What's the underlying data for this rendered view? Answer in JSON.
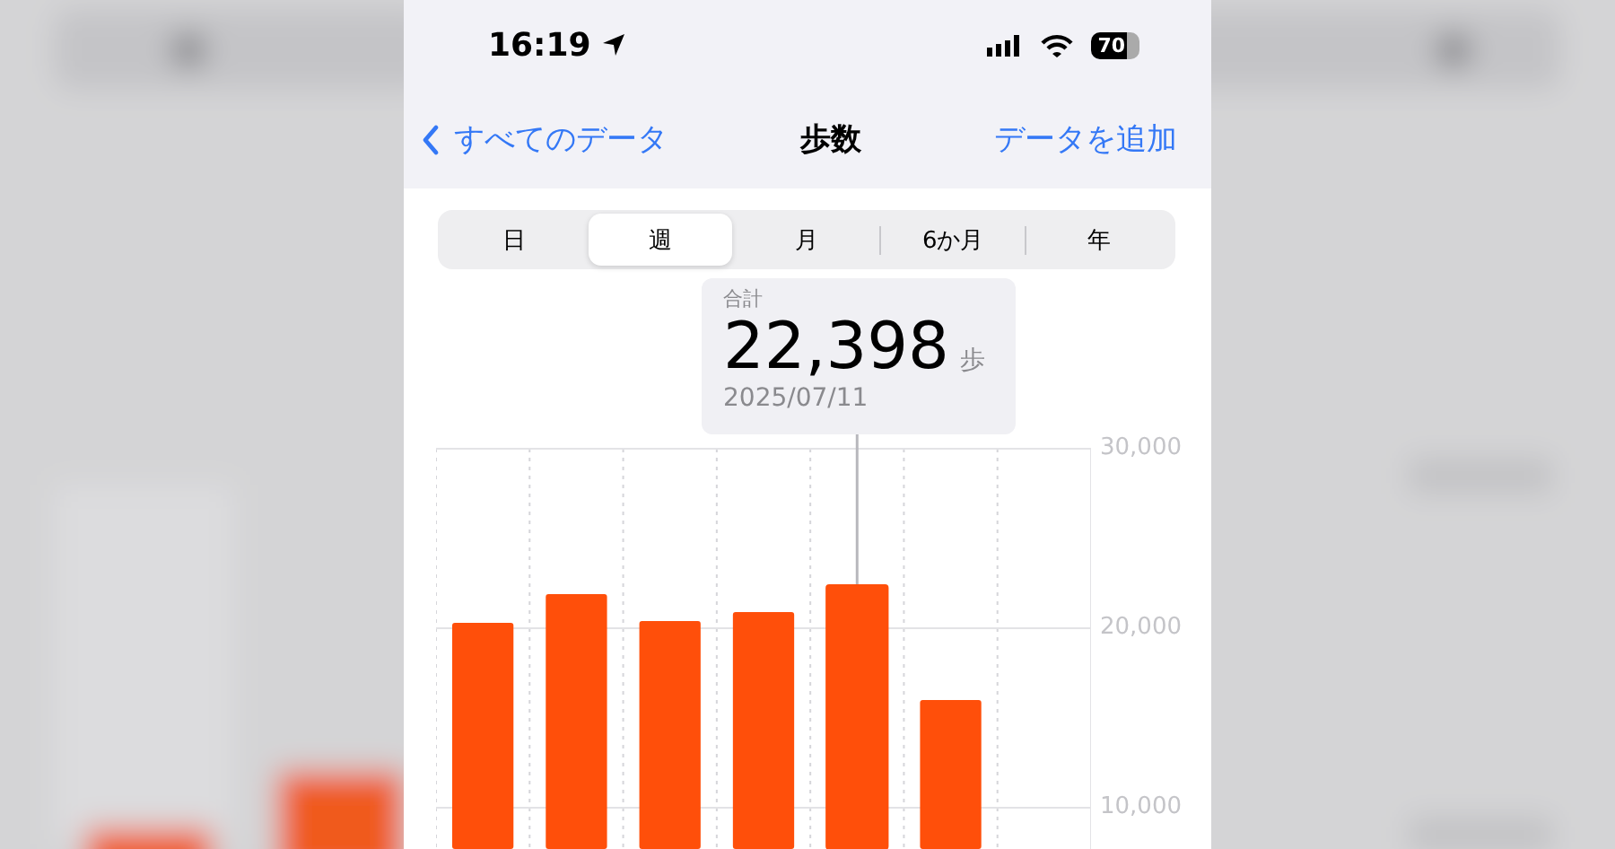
{
  "status_bar": {
    "time": "16:19",
    "battery": "70"
  },
  "nav": {
    "back": "すべてのデータ",
    "title": "歩数",
    "action": "データを追加"
  },
  "tabs": [
    {
      "label": "日",
      "selected": false
    },
    {
      "label": "週",
      "selected": true
    },
    {
      "label": "月",
      "selected": false
    },
    {
      "label": "6か月",
      "selected": false
    },
    {
      "label": "年",
      "selected": false
    }
  ],
  "selection": {
    "label": "合計",
    "value": "22,398",
    "unit": "歩",
    "date": "2025/07/11"
  },
  "bars": [
    {
      "selected": false
    },
    {
      "selected": false
    },
    {
      "selected": false
    },
    {
      "selected": false
    },
    {
      "selected": true
    },
    {
      "selected": false
    }
  ],
  "chart_data": {
    "type": "bar",
    "values": [
      20300,
      21900,
      20400,
      20900,
      22400,
      16000,
      null
    ],
    "ylim": [
      7700,
      30000
    ],
    "yticks": [
      {
        "value": 10000,
        "label": "10,000"
      },
      {
        "value": 20000,
        "label": "20,000"
      },
      {
        "value": 30000,
        "label": "30,000"
      }
    ]
  }
}
